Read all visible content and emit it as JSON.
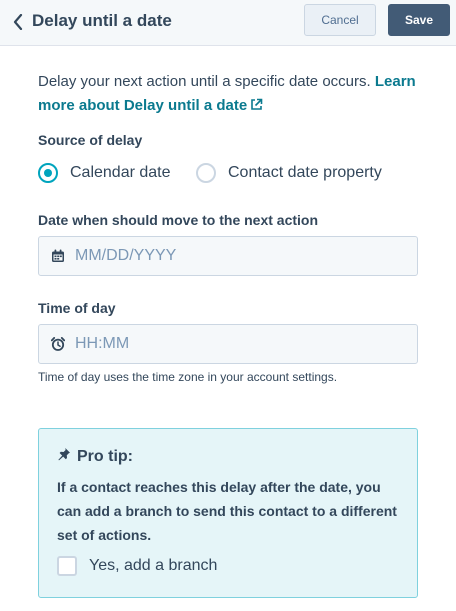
{
  "header": {
    "title": "Delay until a date",
    "back_icon": "chevron-left-icon",
    "cancel_label": "Cancel",
    "save_label": "Save"
  },
  "intro": {
    "text": "Delay your next action until a specific date occurs.",
    "link_text": "Learn more about Delay until a date",
    "link_icon": "external-link-icon"
  },
  "source": {
    "label": "Source of delay",
    "options": [
      {
        "label": "Calendar date",
        "selected": true
      },
      {
        "label": "Contact date property",
        "selected": false
      }
    ]
  },
  "date_field": {
    "label": "Date when should move to the next action",
    "placeholder": "MM/DD/YYYY",
    "value": "",
    "icon": "calendar-icon"
  },
  "time_field": {
    "label": "Time of day",
    "placeholder": "HH:MM",
    "value": "",
    "icon": "alarm-clock-icon",
    "help_text": "Time of day uses the time zone in your account settings."
  },
  "pro_tip": {
    "icon": "pin-icon",
    "title": "Pro tip:",
    "body": "If a contact reaches this delay after the date, you can add a branch to send this contact to a different set of actions.",
    "checkbox_label": "Yes, add a branch",
    "checkbox_checked": false
  },
  "colors": {
    "accent": "#00a4bd",
    "link": "#0b7a8f",
    "primary_button": "#425b76",
    "text": "#33475b",
    "tip_background": "#e5f5f8",
    "tip_border": "#7fd1de"
  }
}
